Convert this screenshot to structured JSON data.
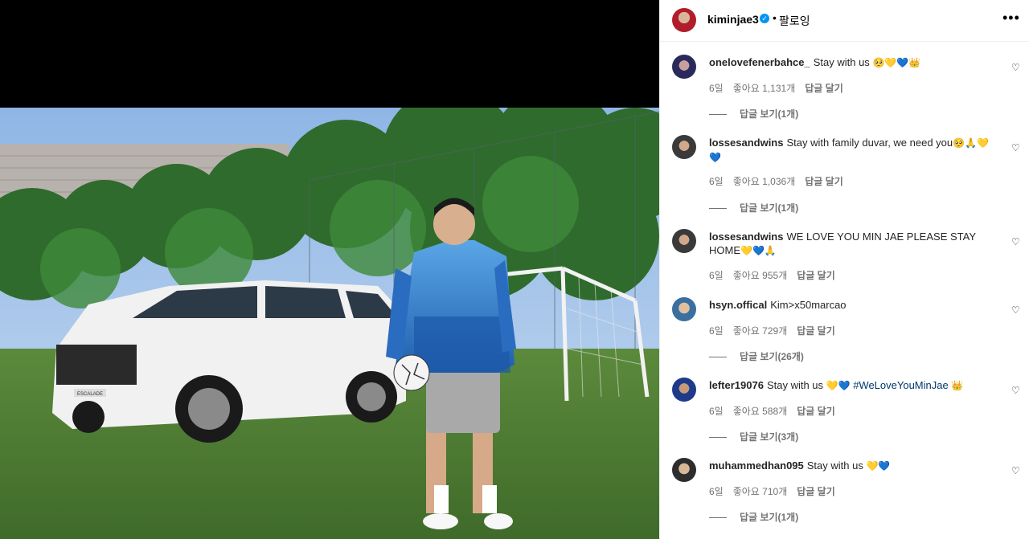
{
  "post": {
    "username": "kiminjae3",
    "separator": "•",
    "follow_label": "팔로잉",
    "more_icon": "more-dots-icon"
  },
  "photo": {
    "car_plate": "ESCALADE"
  },
  "comments": [
    {
      "username": "onelovefenerbahce_",
      "text": "Stay with us",
      "emojis": "🥺💛💙👑",
      "time": "6일",
      "likes": "좋아요 1,131개",
      "reply": "답글 달기",
      "view_replies": "답글 보기(1개)"
    },
    {
      "username": "lossesandwins",
      "text": "Stay with family duvar, we need you",
      "emojis": "🥺🙏💛💙",
      "time": "6일",
      "likes": "좋아요 1,036개",
      "reply": "답글 달기",
      "view_replies": "답글 보기(1개)"
    },
    {
      "username": "lossesandwins",
      "text": "WE LOVE YOU MIN JAE PLEASE STAY HOME",
      "emojis": "💛💙🙏",
      "time": "6일",
      "likes": "좋아요 955개",
      "reply": "답글 달기",
      "view_replies": ""
    },
    {
      "username": "hsyn.offical",
      "text": "Kim>x50marcao",
      "emojis": "",
      "time": "6일",
      "likes": "좋아요 729개",
      "reply": "답글 달기",
      "view_replies": "답글 보기(26개)"
    },
    {
      "username": "lefter19076",
      "text": "Stay with us",
      "emojis": "💛💙",
      "hashtag": "#WeLoveYouMinJae",
      "emojis_after": "👑",
      "time": "6일",
      "likes": "좋아요 588개",
      "reply": "답글 달기",
      "view_replies": "답글 보기(3개)"
    },
    {
      "username": "muhammedhan095",
      "text": "Stay with us",
      "emojis": "💛💙",
      "time": "6일",
      "likes": "좋아요 710개",
      "reply": "답글 달기",
      "view_replies": "답글 보기(1개)"
    }
  ],
  "colors": {
    "accent": "#0095f6",
    "muted": "#737373",
    "hashtag": "#00376b"
  }
}
